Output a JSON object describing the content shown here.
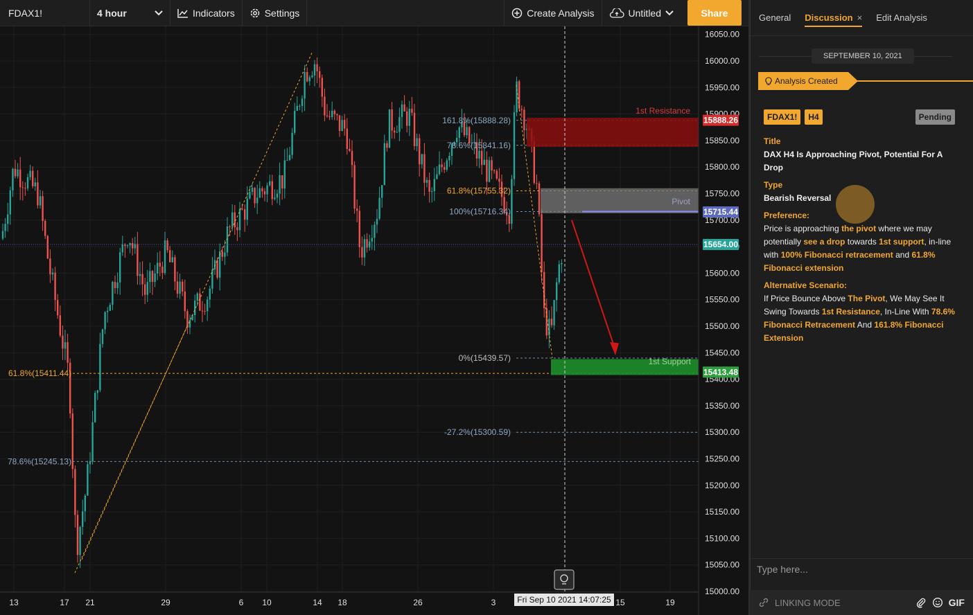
{
  "toolbar": {
    "symbol": "FDAX1!",
    "interval": "4 hour",
    "indicators": "Indicators",
    "settings": "Settings",
    "create_analysis": "Create Analysis",
    "untitled": "Untitled",
    "share": "Share"
  },
  "chart": {
    "price_axis": [
      "16050.00",
      "16000.00",
      "15950.00",
      "15900.00",
      "15850.00",
      "15800.00",
      "15750.00",
      "15700.00",
      "15650.00",
      "15600.00",
      "15550.00",
      "15500.00",
      "15450.00",
      "15400.00",
      "15350.00",
      "15300.00",
      "15250.00",
      "15200.00",
      "15150.00",
      "15100.00",
      "15050.00",
      "15000.00"
    ],
    "date_axis": [
      "13",
      "17",
      "21",
      "29",
      "6",
      "10",
      "14",
      "18",
      "26",
      "3",
      "15",
      "19"
    ],
    "crosshair_date": "Fri Sep 10 2021 14:07:25",
    "price_tags": [
      {
        "label": "15888.26",
        "color": "#d32f2f"
      },
      {
        "label": "15715.44",
        "color": "#5c6bc0"
      },
      {
        "label": "15654.00",
        "color": "#26a69a"
      },
      {
        "label": "15413.48",
        "color": "#2e9e3e"
      }
    ],
    "fib_labels": {
      "f1618": "161.8%(15888.28)",
      "f786": "78.6%(15841.16)",
      "f618": "61.8%(15755.32)",
      "f100": "100%(15716.34)",
      "f0": "0%(15439.57)",
      "f272": "-27.2%(15300.59)",
      "left618": "61.8%(15411.44)",
      "left786": "78.6%(15245.13)"
    },
    "zones": {
      "resistance": "1st Resistance",
      "pivot": "Pivot",
      "support": "1st Support"
    },
    "colors": {
      "up": "#26a69a",
      "down": "#ef5350",
      "resistance": "#8b0f0f",
      "support": "#1e8f2a",
      "pivot": "#7a7a7a",
      "fib_orange": "#f2a72e"
    }
  },
  "panel": {
    "tabs": [
      "General",
      "Discussion",
      "Edit Analysis"
    ],
    "date": "SEPTEMBER 10, 2021",
    "created": "Analysis Created",
    "badge_symbol": "FDAX1!",
    "badge_tf": "H4",
    "status": "Pending",
    "title_label": "Title",
    "title_value": "DAX H4 Is Approaching Pivot, Potential For A Drop",
    "type_label": "Type",
    "type_value": "Bearish Reversal",
    "pref_label": "Preference:",
    "pref_parts": [
      "Price is approaching ",
      "the pivot",
      " where we may potentially ",
      "see a drop",
      " towards ",
      "1st support",
      ", in-line with ",
      "100% Fibonacci retracement",
      " and ",
      "61.8% Fibonacci extension"
    ],
    "alt_label": "Alternative Scenario:",
    "alt_parts": [
      "If Price Bounce Above ",
      "The Pivot",
      ", We May See It Swing Towards ",
      "1st Resistance",
      ", In-Line With ",
      "78.6% Fibonacci Retracement",
      " And ",
      "161.8% Fibonacci Extension"
    ],
    "chat_placeholder": "Type here...",
    "linking_mode": "LINKING MODE",
    "gif": "GIF"
  }
}
